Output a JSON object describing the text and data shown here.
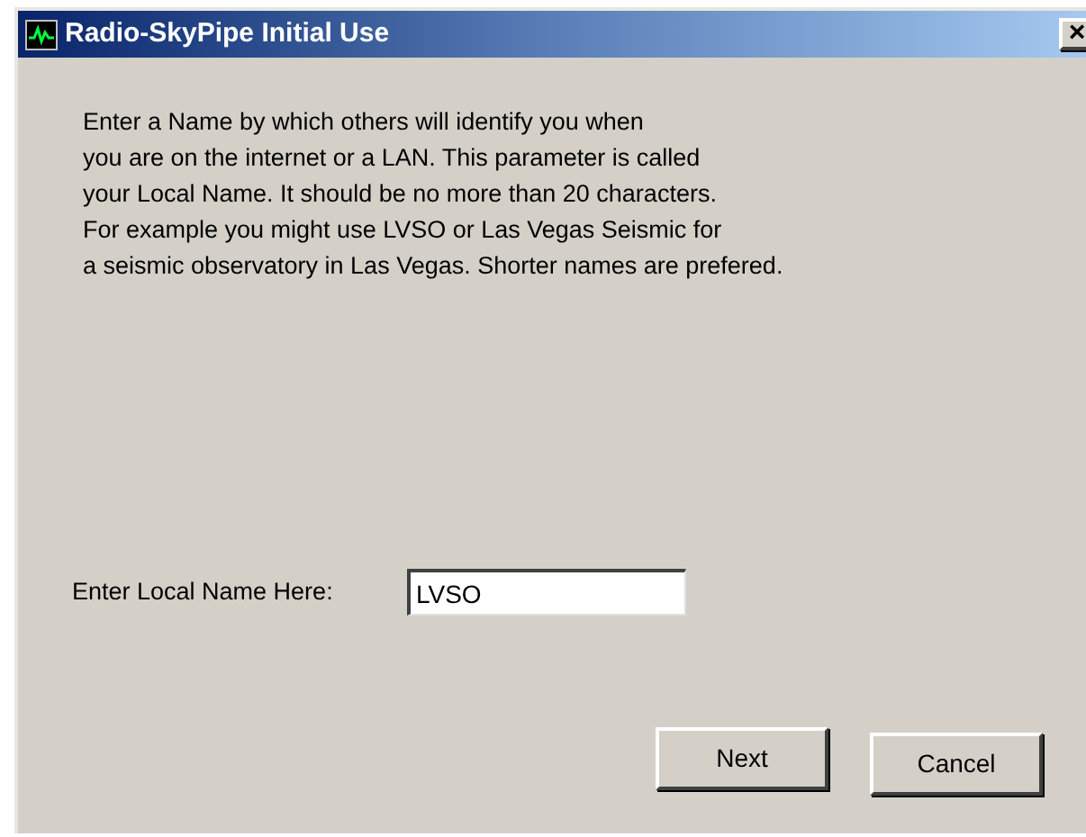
{
  "window": {
    "title": "Radio-SkyPipe Initial Use",
    "close": "×"
  },
  "instructions": "Enter a Name by which others will identify you when\nyou are on the internet or a LAN. This parameter is called\nyour Local Name. It should be no more than 20 characters.\nFor example you might use LVSO or Las Vegas Seismic for\na seismic observatory in Las Vegas. Shorter names are prefered.",
  "local_name": {
    "label": "Enter Local Name Here:",
    "value": "LVSO"
  },
  "buttons": [
    {
      "label": "Next"
    },
    {
      "label": "Cancel"
    }
  ]
}
